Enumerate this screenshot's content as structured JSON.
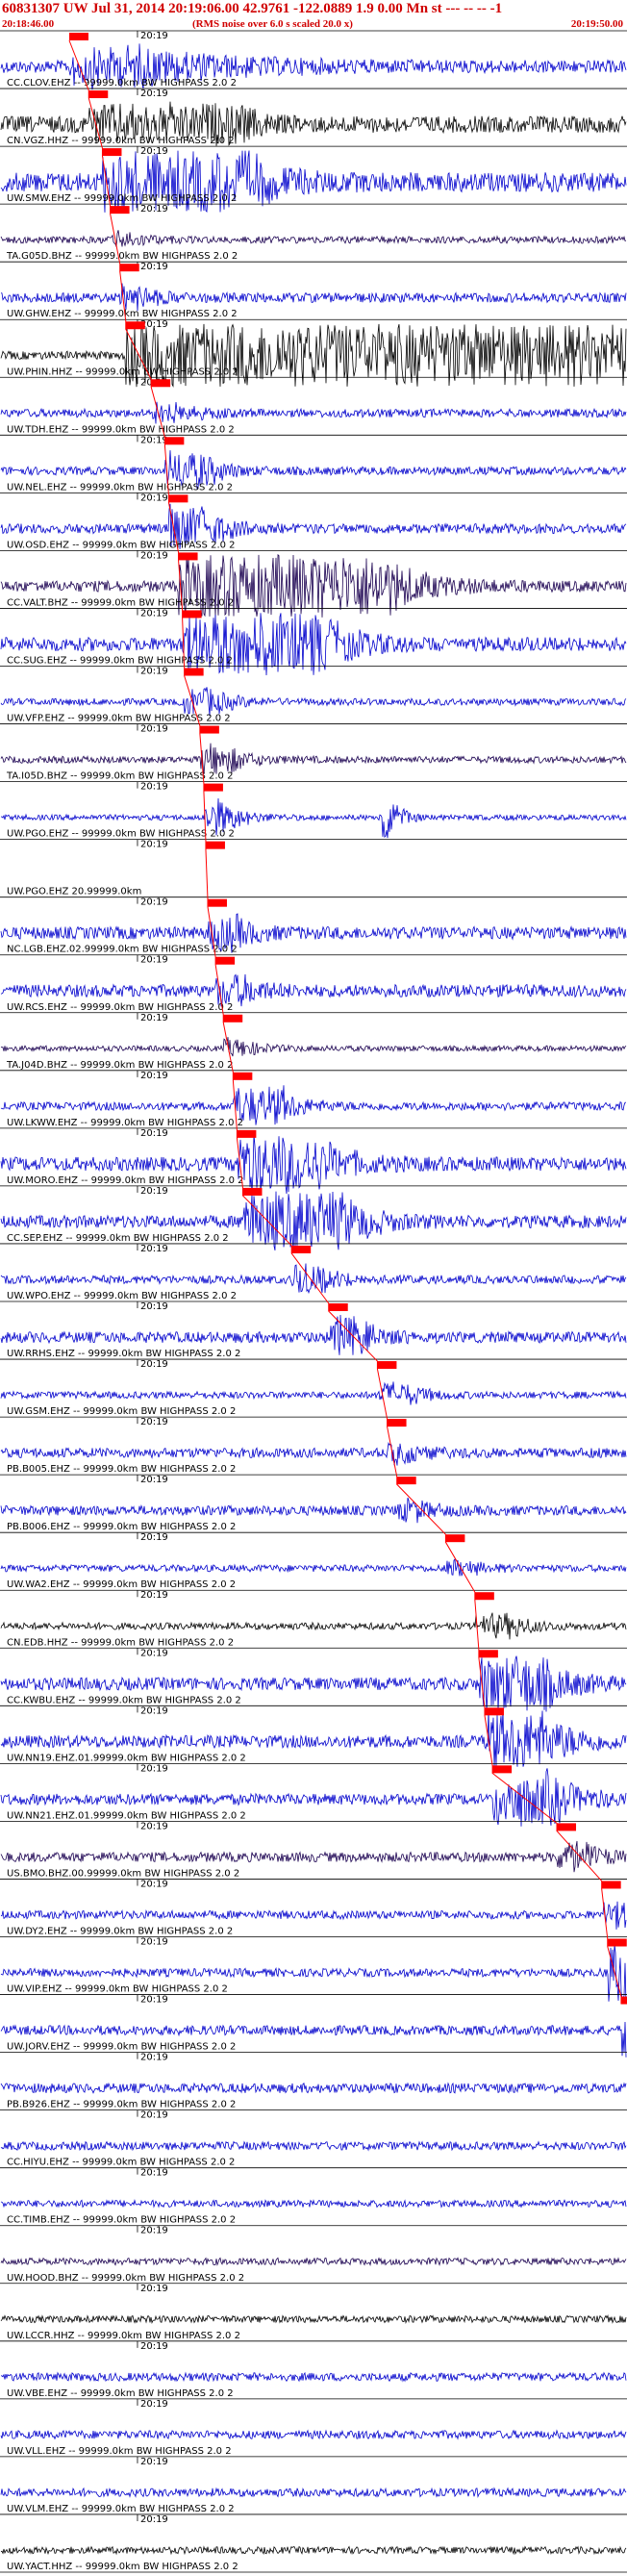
{
  "header": {
    "title": "60831307 UW Jul 31, 2014 20:19:06.00   42.9761 -122.0889  1.9 0.00 Mn st --- -- --  -1",
    "start_time": "20:18:46.00",
    "scale_note": "(RMS noise over 6.0 s scaled 20.0 x)",
    "end_time": "20:19:50.00"
  },
  "colors": {
    "header": "#d00000",
    "pick": "#ff0000",
    "trace_blue": "#0000cc",
    "trace_black": "#000000",
    "trace_navy": "#1a0050"
  },
  "chart_data": {
    "type": "seismogram",
    "x_range_seconds": [
      0,
      64
    ],
    "minute_tick_label": "20:19",
    "minute_tick_seconds": 14,
    "traces": [
      {
        "label": "CC.CLOV.EHZ -- 99999.0km BW  HIGHPASS  2.0  2",
        "pick_s": 7.0,
        "amp": 0.9,
        "color": "blue",
        "events": [
          [
            7,
            8,
            9,
            1.0
          ]
        ]
      },
      {
        "label": "CN.VGZ.HHZ -- 99999.0km BW  HIGHPASS  2.0  2",
        "pick_s": 9.0,
        "amp": 1.2,
        "color": "black",
        "events": [
          [
            9,
            16,
            2,
            0.8
          ]
        ]
      },
      {
        "label": "UW.SMW.EHZ -- 99999.0km BW  HIGHPASS  2.0  2",
        "pick_s": 10.4,
        "amp": 1.4,
        "color": "blue",
        "events": [
          [
            10.4,
            15,
            3,
            1.6
          ]
        ]
      },
      {
        "label": "TA.G05D.BHZ -- 99999.0km BW  HIGHPASS  2.0  2",
        "pick_s": 11.2,
        "amp": 0.5,
        "color": "navy",
        "events": [
          [
            11.2,
            2,
            2,
            0.4
          ]
        ]
      },
      {
        "label": "UW.GHW.EHZ -- 99999.0km BW  HIGHPASS  2.0  2",
        "pick_s": 12.2,
        "amp": 0.7,
        "color": "blue",
        "events": [
          [
            12.2,
            2,
            2,
            0.6
          ]
        ]
      },
      {
        "label": "UW.PHIN.HHZ -- 99999.0km BW  HIGHPASS  2.0  2",
        "pick_s": 12.8,
        "amp": 0.6,
        "color": "black",
        "events": [
          [
            12.8,
            52,
            8,
            2.6
          ]
        ]
      },
      {
        "label": "UW.TDH.EHZ -- 99999.0km BW  HIGHPASS  2.0  2",
        "pick_s": 15.4,
        "amp": 0.6,
        "color": "blue",
        "events": [
          [
            15.4,
            3,
            2,
            0.5
          ]
        ]
      },
      {
        "label": "UW.NEL.EHZ -- 99999.0km BW  HIGHPASS  2.0  2",
        "pick_s": 16.8,
        "amp": 0.6,
        "color": "blue",
        "events": [
          [
            16.8,
            4,
            2,
            1.0
          ]
        ]
      },
      {
        "label": "UW.OSD.EHZ -- 99999.0km BW  HIGHPASS  2.0  2",
        "pick_s": 17.2,
        "amp": 0.7,
        "color": "blue",
        "events": [
          [
            17.2,
            4,
            2,
            1.2
          ]
        ]
      },
      {
        "label": "CC.VALT.BHZ -- 99999.0km BW  HIGHPASS  2.0  2",
        "pick_s": 18.2,
        "amp": 0.8,
        "color": "navy",
        "events": [
          [
            18.2,
            20,
            4,
            2.2
          ]
        ]
      },
      {
        "label": "CC.SUG.EHZ -- 99999.0km BW  HIGHPASS  2.0  2",
        "pick_s": 18.6,
        "amp": 1.0,
        "color": "blue",
        "events": [
          [
            18.6,
            14,
            3,
            1.8
          ]
        ]
      },
      {
        "label": "UW.VFP.EHZ -- 99999.0km BW  HIGHPASS  2.0  2",
        "pick_s": 18.8,
        "amp": 0.5,
        "color": "blue",
        "events": [
          [
            18.8,
            3,
            2,
            0.7
          ]
        ]
      },
      {
        "label": "TA.I05D.BHZ -- 99999.0km BW  HIGHPASS  2.0  2",
        "pick_s": 20.4,
        "amp": 0.5,
        "color": "navy",
        "events": [
          [
            20.4,
            3,
            2,
            0.8
          ]
        ]
      },
      {
        "label": "UW.PGO.EHZ -- 99999.0km BW  HIGHPASS  2.0  2",
        "pick_s": 20.8,
        "amp": 0.4,
        "color": "blue",
        "events": [
          [
            20.8,
            2,
            2,
            1.0
          ],
          [
            39,
            1,
            1,
            1.4
          ]
        ]
      },
      {
        "label": "UW.PGO.EHZ 20.99999.0km",
        "pick_s": 21.0,
        "amp": 0.0,
        "color": "blue",
        "events": []
      },
      {
        "label": "NC.LGB.EHZ.02.99999.0km BW  HIGHPASS  2.0  2",
        "pick_s": 21.2,
        "amp": 0.9,
        "color": "blue",
        "events": [
          [
            21.2,
            3,
            2,
            0.8
          ]
        ]
      },
      {
        "label": "UW.RCS.EHZ -- 99999.0km BW  HIGHPASS  2.0  2",
        "pick_s": 22.0,
        "amp": 0.9,
        "color": "blue",
        "events": [
          [
            22,
            3,
            2,
            0.7
          ]
        ]
      },
      {
        "label": "TA.J04D.BHZ -- 99999.0km BW  HIGHPASS  2.0  2",
        "pick_s": 22.8,
        "amp": 0.4,
        "color": "navy",
        "events": [
          [
            22.8,
            2,
            2,
            0.5
          ]
        ]
      },
      {
        "label": "UW.LKWW.EHZ -- 99999.0km BW  HIGHPASS  2.0  2",
        "pick_s": 23.8,
        "amp": 0.6,
        "color": "blue",
        "events": [
          [
            23.8,
            5,
            2,
            1.0
          ]
        ]
      },
      {
        "label": "UW.MORO.EHZ -- 99999.0km BW  HIGHPASS  2.0  2",
        "pick_s": 24.2,
        "amp": 1.0,
        "color": "blue",
        "events": [
          [
            24.2,
            8,
            3,
            1.6
          ]
        ]
      },
      {
        "label": "CC.SEP.EHZ -- 99999.0km BW  HIGHPASS  2.0  2",
        "pick_s": 24.8,
        "amp": 0.9,
        "color": "blue",
        "events": [
          [
            24.8,
            10,
            3,
            1.6
          ]
        ]
      },
      {
        "label": "UW.WPO.EHZ -- 99999.0km BW  HIGHPASS  2.0  2",
        "pick_s": 29.8,
        "amp": 0.6,
        "color": "blue",
        "events": [
          [
            29.8,
            3,
            2,
            0.8
          ]
        ]
      },
      {
        "label": "UW.RRHS.EHZ -- 99999.0km BW  HIGHPASS  2.0  2",
        "pick_s": 33.6,
        "amp": 0.8,
        "color": "blue",
        "events": [
          [
            33.6,
            3,
            2,
            1.0
          ]
        ]
      },
      {
        "label": "UW.GSM.EHZ -- 99999.0km BW  HIGHPASS  2.0  2",
        "pick_s": 38.6,
        "amp": 0.5,
        "color": "blue",
        "events": [
          [
            38.6,
            3,
            2,
            0.6
          ]
        ]
      },
      {
        "label": "PB.B005.EHZ -- 99999.0km BW  HIGHPASS  2.0  2",
        "pick_s": 39.6,
        "amp": 0.7,
        "color": "blue",
        "events": [
          [
            39.6,
            2,
            2,
            0.5
          ]
        ]
      },
      {
        "label": "PB.B006.EHZ -- 99999.0km BW  HIGHPASS  2.0  2",
        "pick_s": 40.6,
        "amp": 0.7,
        "color": "blue",
        "events": [
          [
            40.6,
            2,
            2,
            0.5
          ]
        ]
      },
      {
        "label": "UW.WA2.EHZ -- 99999.0km BW  HIGHPASS  2.0  2",
        "pick_s": 45.6,
        "amp": 0.5,
        "color": "blue",
        "events": [
          [
            45.6,
            2,
            2,
            0.4
          ]
        ]
      },
      {
        "label": "CN.EDB.HHZ -- 99999.0km BW  HIGHPASS  2.0  2",
        "pick_s": 48.6,
        "amp": 0.5,
        "color": "black",
        "events": [
          [
            48.6,
            4,
            2,
            0.6
          ]
        ]
      },
      {
        "label": "CC.KWBU.EHZ -- 99999.0km BW  HIGHPASS  2.0  2",
        "pick_s": 49.0,
        "amp": 0.9,
        "color": "blue",
        "events": [
          [
            49,
            6,
            3,
            1.6
          ]
        ]
      },
      {
        "label": "UW.NN19.EHZ.01.99999.0km BW  HIGHPASS  2.0  2",
        "pick_s": 49.6,
        "amp": 0.9,
        "color": "blue",
        "events": [
          [
            49.6,
            6,
            3,
            1.6
          ]
        ]
      },
      {
        "label": "UW.NN21.EHZ.01.99999.0km BW  HIGHPASS  2.0  2",
        "pick_s": 50.4,
        "amp": 0.8,
        "color": "blue",
        "events": [
          [
            50.4,
            6,
            3,
            1.4
          ]
        ]
      },
      {
        "label": "US.BMO.BHZ.00.99999.0km BW  HIGHPASS  2.0  2",
        "pick_s": 57.0,
        "amp": 0.7,
        "color": "navy",
        "events": [
          [
            57,
            3,
            2,
            0.7
          ]
        ]
      },
      {
        "label": "UW.DY2.EHZ -- 99999.0km BW  HIGHPASS  2.0  2",
        "pick_s": 61.6,
        "amp": 0.6,
        "color": "blue",
        "events": [
          [
            61.6,
            2,
            2,
            0.8
          ]
        ]
      },
      {
        "label": "UW.VIP.EHZ -- 99999.0km BW  HIGHPASS  2.0  2",
        "pick_s": 62.2,
        "amp": 0.6,
        "color": "blue",
        "events": [
          [
            62.2,
            2,
            2,
            2.2
          ]
        ]
      },
      {
        "label": "UW.JORV.EHZ -- 99999.0km BW  HIGHPASS  2.0  2",
        "pick_s": 63.6,
        "amp": 0.7,
        "color": "blue",
        "events": [
          [
            63.6,
            1,
            1,
            1.8
          ]
        ]
      },
      {
        "label": "PB.B926.EHZ -- 99999.0km BW  HIGHPASS  2.0  2",
        "pick_s": null,
        "amp": 0.7,
        "color": "blue",
        "events": []
      },
      {
        "label": "CC.HIYU.EHZ -- 99999.0km BW  HIGHPASS  2.0  2",
        "pick_s": null,
        "amp": 0.6,
        "color": "blue",
        "events": []
      },
      {
        "label": "CC.TIMB.EHZ -- 99999.0km BW  HIGHPASS  2.0  2",
        "pick_s": null,
        "amp": 0.5,
        "color": "blue",
        "events": []
      },
      {
        "label": "UW.HOOD.BHZ -- 99999.0km BW  HIGHPASS  2.0  2",
        "pick_s": null,
        "amp": 0.5,
        "color": "navy",
        "events": []
      },
      {
        "label": "UW.LCCR.HHZ -- 99999.0km BW  HIGHPASS  2.0  2",
        "pick_s": null,
        "amp": 0.5,
        "color": "black",
        "events": []
      },
      {
        "label": "UW.VBE.EHZ -- 99999.0km BW  HIGHPASS  2.0  2",
        "pick_s": null,
        "amp": 0.6,
        "color": "blue",
        "events": []
      },
      {
        "label": "UW.VLL.EHZ -- 99999.0km BW  HIGHPASS  2.0  2",
        "pick_s": null,
        "amp": 0.6,
        "color": "blue",
        "events": []
      },
      {
        "label": "UW.VLM.EHZ -- 99999.0km BW  HIGHPASS  2.0  2",
        "pick_s": null,
        "amp": 0.6,
        "color": "blue",
        "events": []
      },
      {
        "label": "UW.YACT.HHZ -- 99999.0km BW  HIGHPASS  2.0  2",
        "pick_s": null,
        "amp": 0.5,
        "color": "black",
        "events": []
      }
    ]
  }
}
